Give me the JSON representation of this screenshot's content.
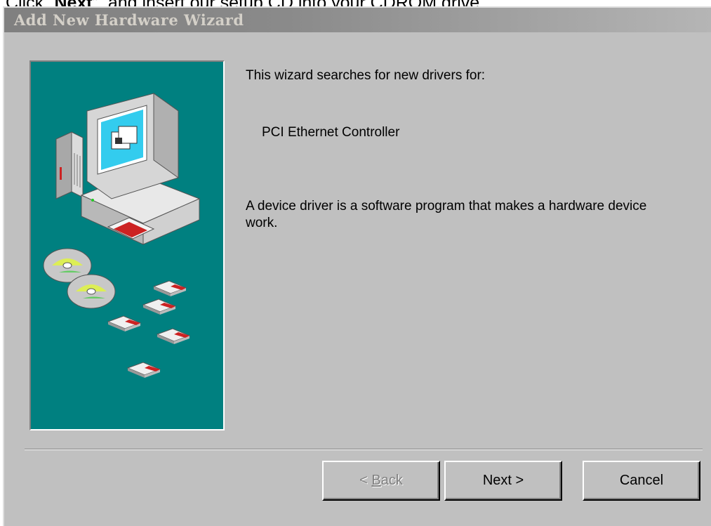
{
  "instruction": {
    "prefix": "Click “",
    "bold": "Next",
    "suffix": "”, and insert our setup CD into your CDROM drive."
  },
  "window": {
    "title": "Add New Hardware Wizard"
  },
  "content": {
    "intro": "This wizard searches for new drivers for:",
    "device_name": "PCI Ethernet Controller",
    "description": "A device driver is a software program that makes a hardware device work."
  },
  "buttons": {
    "back_pre": "< ",
    "back_accel": "B",
    "back_post": "ack",
    "next": "Next >",
    "cancel": "Cancel"
  },
  "colors": {
    "illustration_bg": "#008080",
    "dialog_bg": "#c0c0c0"
  }
}
